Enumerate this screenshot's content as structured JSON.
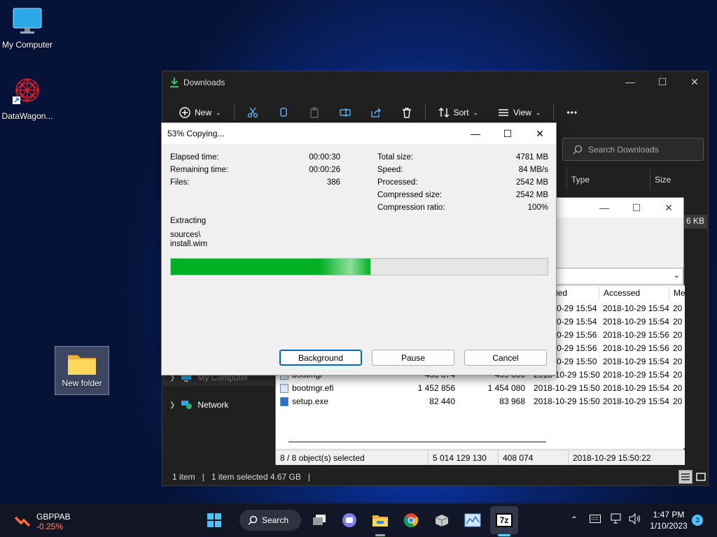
{
  "desktop": {
    "icons": [
      {
        "label": "My Computer"
      },
      {
        "label": "DataWagon..."
      },
      {
        "label": "New folder"
      }
    ]
  },
  "explorer": {
    "title": "Downloads",
    "toolbar": {
      "new": "New",
      "sort": "Sort",
      "view": "View",
      "more": "•••"
    },
    "search_placeholder": "Search Downloads",
    "columns": {
      "type": "Type",
      "size": "Size"
    },
    "partial_size": "6 KB",
    "nav": [
      {
        "label": "My Computer"
      },
      {
        "label": "Network"
      }
    ],
    "status": {
      "items": "1 item",
      "selected": "1 item selected  4.67 GB"
    }
  },
  "sevenzip": {
    "columns": {
      "modified": "ied",
      "accessed": "Accessed",
      "more": "Me"
    },
    "rows": [
      {
        "name": "",
        "size": "",
        "packed": "",
        "modified": "0-29 15:54",
        "accessed": "2018-10-29 15:54",
        "more": "20"
      },
      {
        "name": "",
        "size": "",
        "packed": "",
        "modified": "0-29 15:54",
        "accessed": "2018-10-29 15:54",
        "more": "20"
      },
      {
        "name": "",
        "size": "",
        "packed": "",
        "modified": "0-29 15:56",
        "accessed": "2018-10-29 15:56",
        "more": "20"
      },
      {
        "name": "",
        "size": "",
        "packed": "",
        "modified": "0-29 15:56",
        "accessed": "2018-10-29 15:56",
        "more": "20"
      },
      {
        "name": "",
        "size": "",
        "packed": "",
        "modified": "0-29 15:50",
        "accessed": "2018-10-29 15:54",
        "more": "20"
      },
      {
        "name": "bootmgr",
        "size": "408 074",
        "packed": "409 600",
        "modified": "2018-10-29 15:50",
        "accessed": "2018-10-29 15:54",
        "more": "20"
      },
      {
        "name": "bootmgr.efi",
        "size": "1 452 856",
        "packed": "1 454 080",
        "modified": "2018-10-29 15:50",
        "accessed": "2018-10-29 15:54",
        "more": "20"
      },
      {
        "name": "setup.exe",
        "size": "82 440",
        "packed": "83 968",
        "modified": "2018-10-29 15:50",
        "accessed": "2018-10-29 15:54",
        "more": "20"
      }
    ],
    "status": {
      "selected": "8 / 8 object(s) selected",
      "total": "5 014 129 130",
      "size": "408 074",
      "date": "2018-10-29 15:50:22"
    }
  },
  "dialog": {
    "title": "53% Copying...",
    "left": [
      {
        "label": "Elapsed time:",
        "value": "00:00:30"
      },
      {
        "label": "Remaining time:",
        "value": "00:00:26"
      },
      {
        "label": "Files:",
        "value": "386"
      }
    ],
    "right": [
      {
        "label": "Total size:",
        "value": "4781 MB"
      },
      {
        "label": "Speed:",
        "value": "84 MB/s"
      },
      {
        "label": "Processed:",
        "value": "2542 MB"
      },
      {
        "label": "Compressed size:",
        "value": "2542 MB"
      },
      {
        "label": "Compression ratio:",
        "value": "100%"
      }
    ],
    "operation": "Extracting",
    "path1": "sources\\",
    "path2": "install.wim",
    "progress_percent": 53,
    "buttons": {
      "background": "Background",
      "pause": "Pause",
      "cancel": "Cancel"
    }
  },
  "taskbar": {
    "stock": {
      "name": "GBPPAB",
      "change": "-0.25%"
    },
    "search_label": "Search",
    "time": "1:47 PM",
    "date": "1/10/2023",
    "notif_count": "3"
  },
  "colors": {
    "accent": "#0067c0",
    "progress": "#06b025",
    "stock_down": "#ff6b5b"
  }
}
